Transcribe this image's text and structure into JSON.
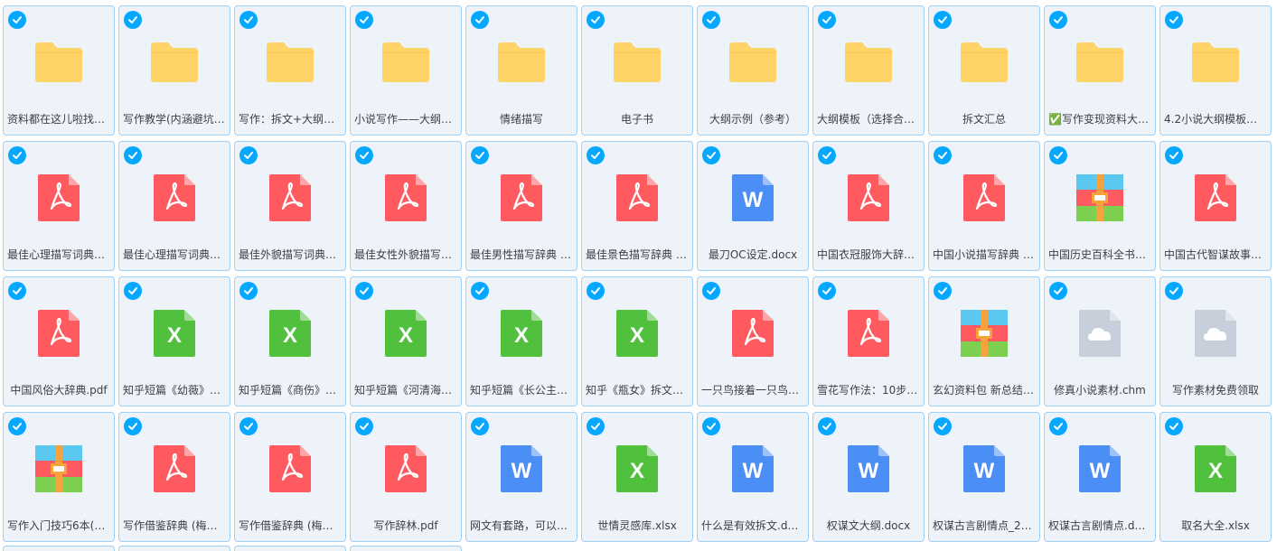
{
  "colors": {
    "selected_border": "#9fd0f5",
    "tile_bg": "#eef3fa",
    "check_bg": "#06a7ff",
    "folder": "#ffd467",
    "pdf": "#ff5a5f",
    "word": "#4b8ef5",
    "excel": "#51c03d",
    "cloud": "#c7d0da"
  },
  "files": [
    {
      "name": "资料都在这儿啦找…",
      "icon": "folder-icon",
      "type": "folder",
      "align": "left"
    },
    {
      "name": "写作教学(内涵避坑…",
      "icon": "folder-icon",
      "type": "folder",
      "align": "left"
    },
    {
      "name": "写作：拆文+大纲+…",
      "icon": "folder-icon",
      "type": "folder",
      "align": "left"
    },
    {
      "name": "小说写作——大纲…",
      "icon": "folder-icon",
      "type": "folder",
      "align": "left"
    },
    {
      "name": "情绪描写",
      "icon": "folder-icon",
      "type": "folder",
      "align": "center"
    },
    {
      "name": "电子书",
      "icon": "folder-icon",
      "type": "folder",
      "align": "center"
    },
    {
      "name": "大纲示例（参考）",
      "icon": "folder-icon",
      "type": "folder",
      "align": "center"
    },
    {
      "name": "大纲模板（选择合…",
      "icon": "folder-icon",
      "type": "folder",
      "align": "left"
    },
    {
      "name": "拆文汇总",
      "icon": "folder-icon",
      "type": "folder",
      "align": "center"
    },
    {
      "name": "✅写作变现资料大…",
      "icon": "folder-icon",
      "type": "folder",
      "align": "left"
    },
    {
      "name": "4.2小说大纲模板…",
      "icon": "folder-icon",
      "type": "folder",
      "align": "left"
    },
    {
      "name": "最佳心理描写词典…",
      "icon": "pdf-icon",
      "type": "pdf",
      "align": "left"
    },
    {
      "name": "最佳心理描写词典…",
      "icon": "pdf-icon",
      "type": "pdf",
      "align": "left"
    },
    {
      "name": "最佳外貌描写词典…",
      "icon": "pdf-icon",
      "type": "pdf",
      "align": "left"
    },
    {
      "name": "最佳女性外貌描写…",
      "icon": "pdf-icon",
      "type": "pdf",
      "align": "left"
    },
    {
      "name": "最佳男性描写辞典 …",
      "icon": "pdf-icon",
      "type": "pdf",
      "align": "left"
    },
    {
      "name": "最佳景色描写辞典 …",
      "icon": "pdf-icon",
      "type": "pdf",
      "align": "left"
    },
    {
      "name": "最刀OC设定.docx",
      "icon": "word-icon",
      "type": "word",
      "align": "center"
    },
    {
      "name": "中国衣冠服饰大辞…",
      "icon": "pdf-icon",
      "type": "pdf",
      "align": "left"
    },
    {
      "name": "中国小说描写辞典 …",
      "icon": "pdf-icon",
      "type": "pdf",
      "align": "left"
    },
    {
      "name": "中国历史百科全书…",
      "icon": "archive-icon",
      "type": "archive",
      "align": "left"
    },
    {
      "name": "中国古代智谋故事…",
      "icon": "pdf-icon",
      "type": "pdf",
      "align": "left"
    },
    {
      "name": "中国风俗大辞典.pdf",
      "icon": "pdf-icon",
      "type": "pdf",
      "align": "center"
    },
    {
      "name": "知乎短篇《幼薇》…",
      "icon": "excel-icon",
      "type": "excel",
      "align": "left"
    },
    {
      "name": "知乎短篇《商伤》…",
      "icon": "excel-icon",
      "type": "excel",
      "align": "left"
    },
    {
      "name": "知乎短篇《河清海…",
      "icon": "excel-icon",
      "type": "excel",
      "align": "left"
    },
    {
      "name": "知乎短篇《长公主…",
      "icon": "excel-icon",
      "type": "excel",
      "align": "left"
    },
    {
      "name": "知乎《瓶女》拆文…",
      "icon": "excel-icon",
      "type": "excel",
      "align": "left"
    },
    {
      "name": "一只鸟接着一只鸟…",
      "icon": "pdf-icon",
      "type": "pdf",
      "align": "left"
    },
    {
      "name": "雪花写作法：10步…",
      "icon": "pdf-icon",
      "type": "pdf",
      "align": "left"
    },
    {
      "name": "玄幻资料包 新总结…",
      "icon": "archive-icon",
      "type": "archive",
      "align": "left"
    },
    {
      "name": "修真小说素材.chm",
      "icon": "cloud-file-icon",
      "type": "cloud",
      "align": "center"
    },
    {
      "name": "写作素材免费领取",
      "icon": "cloud-file-icon",
      "type": "cloud",
      "align": "center"
    },
    {
      "name": "写作入门技巧6本(…",
      "icon": "archive-icon",
      "type": "archive",
      "align": "left"
    },
    {
      "name": "写作借鉴辞典 (梅…",
      "icon": "pdf-icon",
      "type": "pdf",
      "align": "left"
    },
    {
      "name": "写作借鉴辞典 (梅…",
      "icon": "pdf-icon",
      "type": "pdf",
      "align": "left"
    },
    {
      "name": "写作辞林.pdf",
      "icon": "pdf-icon",
      "type": "pdf",
      "align": "center"
    },
    {
      "name": "网文有套路，可以…",
      "icon": "word-icon",
      "type": "word",
      "align": "left"
    },
    {
      "name": "世情灵感库.xlsx",
      "icon": "excel-icon",
      "type": "excel",
      "align": "center"
    },
    {
      "name": "什么是有效拆文.d…",
      "icon": "word-icon",
      "type": "word",
      "align": "left"
    },
    {
      "name": "权谋文大纲.docx",
      "icon": "word-icon",
      "type": "word",
      "align": "center"
    },
    {
      "name": "权谋古言剧情点_2…",
      "icon": "word-icon",
      "type": "word",
      "align": "left"
    },
    {
      "name": "权谋古言剧情点.d…",
      "icon": "word-icon",
      "type": "word",
      "align": "left"
    },
    {
      "name": "取名大全.xlsx",
      "icon": "excel-icon",
      "type": "excel",
      "align": "center"
    }
  ],
  "partial_row_count": 4
}
